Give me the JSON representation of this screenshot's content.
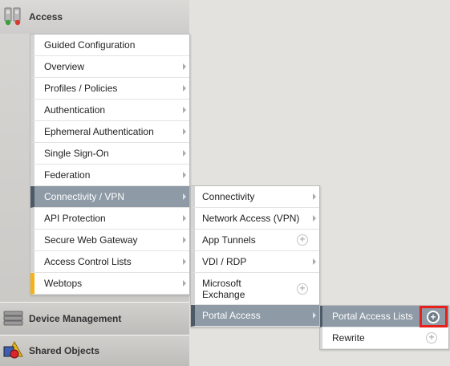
{
  "sidebar": {
    "access": {
      "label": "Access",
      "icon": "access-icon"
    },
    "device": {
      "label": "Device Management",
      "icon": "device-icon"
    },
    "shared": {
      "label": "Shared Objects",
      "icon": "shared-objects-icon"
    }
  },
  "menu1": [
    {
      "label": "Guided Configuration"
    },
    {
      "label": "Overview"
    },
    {
      "label": "Profiles / Policies"
    },
    {
      "label": "Authentication"
    },
    {
      "label": "Ephemeral Authentication"
    },
    {
      "label": "Single Sign-On"
    },
    {
      "label": "Federation"
    },
    {
      "label": "Connectivity / VPN"
    },
    {
      "label": "API Protection"
    },
    {
      "label": "Secure Web Gateway"
    },
    {
      "label": "Access Control Lists"
    },
    {
      "label": "Webtops"
    }
  ],
  "menu2": [
    {
      "label": "Connectivity"
    },
    {
      "label": "Network Access (VPN)"
    },
    {
      "label": "App Tunnels"
    },
    {
      "label": "VDI / RDP"
    },
    {
      "label": "Microsoft Exchange"
    },
    {
      "label": "Portal Access"
    }
  ],
  "menu3": [
    {
      "label": "Portal Access Lists"
    },
    {
      "label": "Rewrite"
    }
  ],
  "colors": {
    "selected": "#8e9aa6",
    "highlight": "#e8201c",
    "accent": "#f2b41a"
  }
}
